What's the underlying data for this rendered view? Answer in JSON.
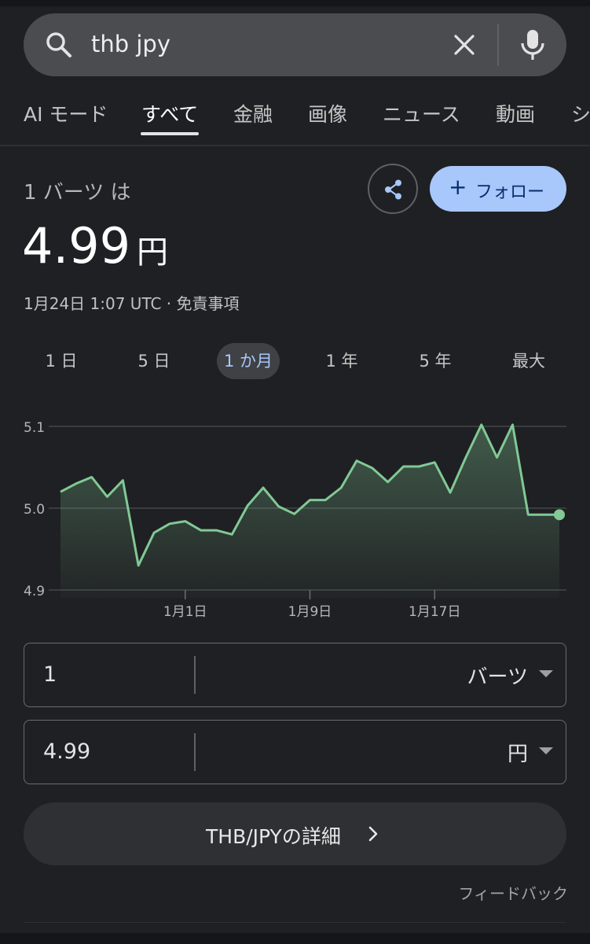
{
  "search": {
    "query": "thb jpy"
  },
  "tabs": [
    {
      "label": "AI モード",
      "active": false
    },
    {
      "label": "すべて",
      "active": true
    },
    {
      "label": "金融",
      "active": false
    },
    {
      "label": "画像",
      "active": false
    },
    {
      "label": "ニュース",
      "active": false
    },
    {
      "label": "動画",
      "active": false
    },
    {
      "label": "シ",
      "active": false
    }
  ],
  "header": {
    "subtitle": "1 バーツ は",
    "rate_value": "4.99",
    "rate_unit": "円",
    "datestamp": "1月24日 1:07 UTC · 免責事項",
    "follow_label": "フォロー"
  },
  "ranges": [
    {
      "label": "1 日",
      "active": false
    },
    {
      "label": "5 日",
      "active": false
    },
    {
      "label": "1 か月",
      "active": true
    },
    {
      "label": "1 年",
      "active": false
    },
    {
      "label": "5 年",
      "active": false
    },
    {
      "label": "最大",
      "active": false
    }
  ],
  "chart_data": {
    "type": "area",
    "ylim": [
      4.9,
      5.1
    ],
    "yticks": [
      "5.1",
      "5.0",
      "4.9"
    ],
    "ytick_values": [
      5.1,
      5.0,
      4.9
    ],
    "xtick_labels": [
      "1月1日",
      "1月9日",
      "1月17日"
    ],
    "xtick_index": [
      8,
      16,
      24
    ],
    "line_color": "#81c995",
    "values": [
      5.02,
      5.03,
      5.038,
      5.014,
      5.034,
      4.93,
      4.97,
      4.981,
      4.984,
      4.973,
      4.973,
      4.968,
      5.003,
      5.025,
      5.002,
      4.993,
      5.01,
      5.01,
      5.025,
      5.058,
      5.049,
      5.032,
      5.051,
      5.051,
      5.056,
      5.019,
      5.062,
      5.102,
      5.062,
      5.102,
      4.992,
      4.992,
      4.992
    ]
  },
  "converter": {
    "from_amount": "1",
    "from_currency": "バーツ",
    "to_amount": "4.99",
    "to_currency": "円"
  },
  "details_label": "THB/JPYの詳細",
  "feedback_label": "フィードバック",
  "colors": {
    "background": "#1f2023",
    "accent": "#a8c7fa",
    "chart_line": "#81c995"
  }
}
